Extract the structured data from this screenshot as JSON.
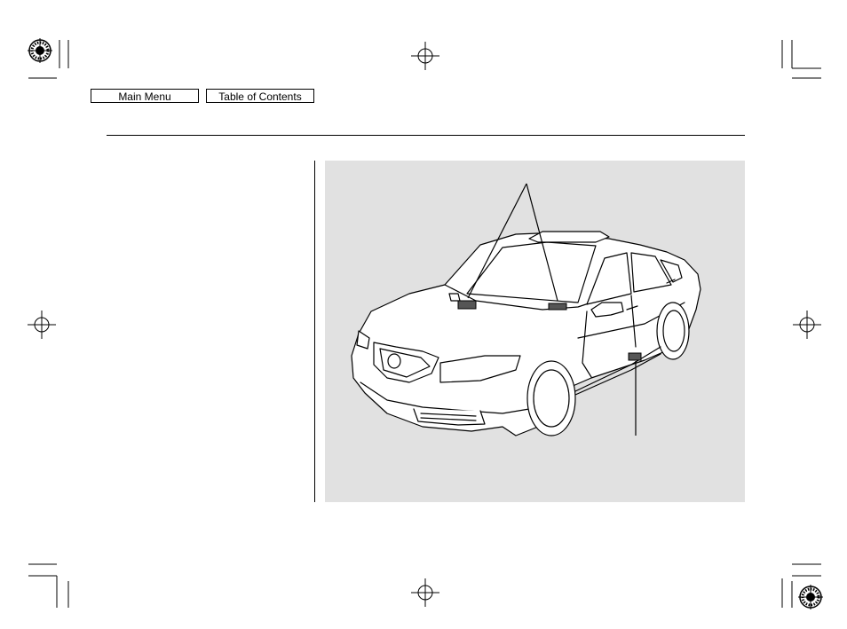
{
  "nav": {
    "main_menu_label": "Main Menu",
    "toc_label": "Table of Contents"
  },
  "colors": {
    "figure_background": "#e1e1e1",
    "label_fill": "#555555",
    "line": "#000000"
  },
  "icons": [
    "registration-mark-icon",
    "crosshair-icon",
    "crop-mark-icon",
    "car-illustration"
  ]
}
